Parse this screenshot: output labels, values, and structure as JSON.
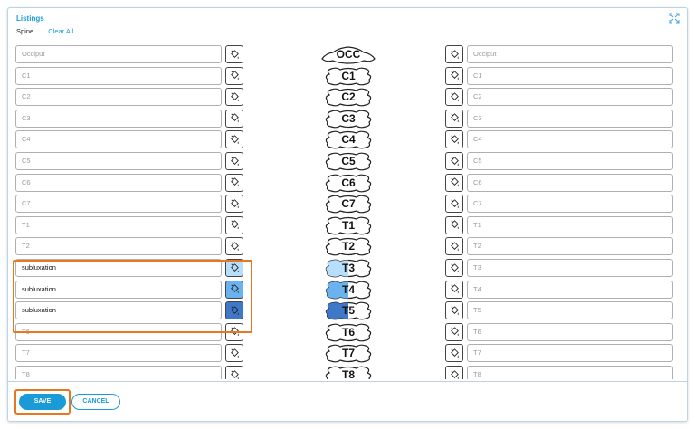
{
  "panel": {
    "title": "Listings",
    "section": "Spine",
    "clear_all": "Clear All"
  },
  "colors": {
    "accent": "#1a9ad6",
    "highlight": "#e87722",
    "t3": "#b7defa",
    "t4": "#6bb3ee",
    "t5": "#3f77c9"
  },
  "rows": [
    {
      "level": "OCC",
      "left_value": "",
      "left_placeholder": "Occiput",
      "right_placeholder": "Occiput"
    },
    {
      "level": "C1",
      "left_value": "",
      "left_placeholder": "C1",
      "right_placeholder": "C1"
    },
    {
      "level": "C2",
      "left_value": "",
      "left_placeholder": "C2",
      "right_placeholder": "C2"
    },
    {
      "level": "C3",
      "left_value": "",
      "left_placeholder": "C3",
      "right_placeholder": "C3"
    },
    {
      "level": "C4",
      "left_value": "",
      "left_placeholder": "C4",
      "right_placeholder": "C4"
    },
    {
      "level": "C5",
      "left_value": "",
      "left_placeholder": "C5",
      "right_placeholder": "C5"
    },
    {
      "level": "C6",
      "left_value": "",
      "left_placeholder": "C6",
      "right_placeholder": "C6"
    },
    {
      "level": "C7",
      "left_value": "",
      "left_placeholder": "C7",
      "right_placeholder": "C7"
    },
    {
      "level": "T1",
      "left_value": "",
      "left_placeholder": "T1",
      "right_placeholder": "T1"
    },
    {
      "level": "T2",
      "left_value": "",
      "left_placeholder": "T2",
      "right_placeholder": "T2"
    },
    {
      "level": "T3",
      "left_value": "subluxation",
      "left_placeholder": "T3",
      "right_placeholder": "T3",
      "color": "#b7defa"
    },
    {
      "level": "T4",
      "left_value": "subluxation",
      "left_placeholder": "T4",
      "right_placeholder": "T4",
      "color": "#6bb3ee"
    },
    {
      "level": "T5",
      "left_value": "subluxation",
      "left_placeholder": "T5",
      "right_placeholder": "T5",
      "color": "#3f77c9"
    },
    {
      "level": "T6",
      "left_value": "",
      "left_placeholder": "T6",
      "right_placeholder": "T6"
    },
    {
      "level": "T7",
      "left_value": "",
      "left_placeholder": "T7",
      "right_placeholder": "T7"
    },
    {
      "level": "T8",
      "left_value": "",
      "left_placeholder": "T8",
      "right_placeholder": "T8"
    }
  ],
  "footer": {
    "save_label": "SAVE",
    "cancel_label": "CANCEL"
  }
}
